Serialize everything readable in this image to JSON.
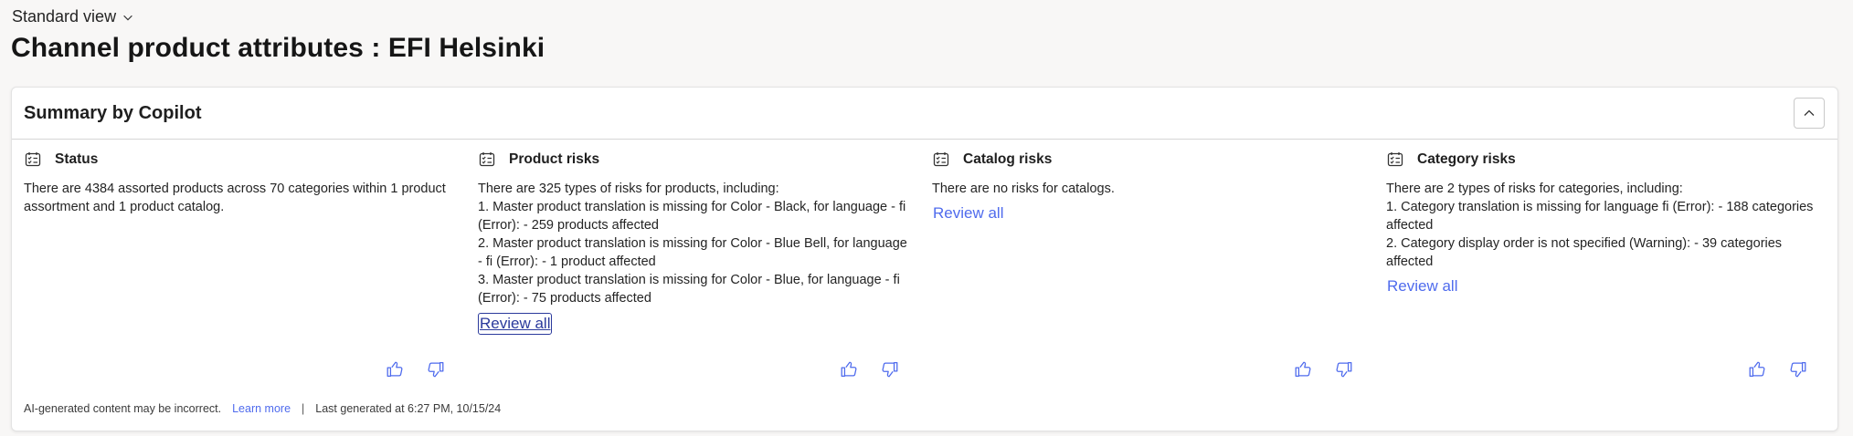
{
  "view_switcher": {
    "label": "Standard view",
    "icon": "chevron-down-icon"
  },
  "page_title": "Channel product attributes : EFI Helsinki",
  "card": {
    "title": "Summary by Copilot",
    "collapse_icon": "chevron-up-icon"
  },
  "columns": [
    {
      "title": "Status",
      "icon": "list-check-icon",
      "lines": [
        "There are 4384 assorted products across 70 categories within 1 product assortment and 1 product catalog."
      ],
      "review_label": ""
    },
    {
      "title": "Product risks",
      "icon": "list-check-icon",
      "lines": [
        "There are 325 types of risks for products, including:",
        "1. Master product translation is missing for Color - Black, for language - fi (Error): - 259 products affected",
        "2. Master product translation is missing for Color - Blue Bell, for language - fi (Error): - 1 product affected",
        "3. Master product translation is missing for Color - Blue, for language - fi (Error): - 75 products affected"
      ],
      "review_label": "Review all"
    },
    {
      "title": "Catalog risks",
      "icon": "list-check-icon",
      "lines": [
        "There are no risks for catalogs."
      ],
      "review_label": "Review all"
    },
    {
      "title": "Category risks",
      "icon": "list-check-icon",
      "lines": [
        "There are 2 types of risks for categories, including:",
        "1. Category translation is missing for language fi (Error): - 188 categories affected",
        "2. Category display order is not specified (Warning): - 39 categories affected"
      ],
      "review_label": "Review all"
    }
  ],
  "feedback": {
    "like_icon": "thumbs-up-icon",
    "dislike_icon": "thumbs-down-icon"
  },
  "footer": {
    "disclaimer": "AI-generated content may be incorrect.",
    "learn_more": "Learn more",
    "separator": "|",
    "last_generated": "Last generated at 6:27 PM, 10/15/24"
  },
  "colors": {
    "accent": "#4f6bed",
    "background": "#f8f7f6",
    "card": "#ffffff"
  }
}
